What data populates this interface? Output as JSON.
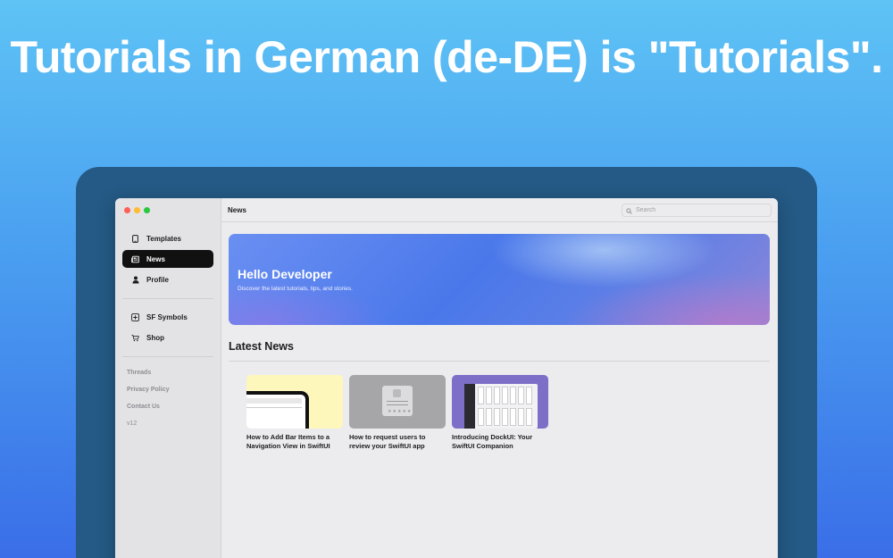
{
  "headline": "Tutorials in German (de-DE) is \"Tutorials\".",
  "colors": {
    "background_top": "#5ec3f5",
    "background_bottom": "#3a6ee8",
    "device": "#245a85",
    "sidebar_active": "#111111",
    "hero_start": "#6a8ff2",
    "hero_end": "#8c86d8"
  },
  "sidebar": {
    "items": [
      {
        "label": "Templates",
        "icon": "phone-icon",
        "active": false
      },
      {
        "label": "News",
        "icon": "newspaper-icon",
        "active": true
      },
      {
        "label": "Profile",
        "icon": "person-icon",
        "active": false
      },
      {
        "label": "SF Symbols",
        "icon": "symbols-grid-icon",
        "active": false
      },
      {
        "label": "Shop",
        "icon": "cart-icon",
        "active": false
      }
    ],
    "links": [
      "Threads",
      "Privacy Policy",
      "Contact Us"
    ],
    "version": "v12"
  },
  "topbar": {
    "title": "News",
    "search_placeholder": "Search"
  },
  "hero": {
    "title": "Hello Developer",
    "subtitle": "Discover the latest tutorials, tips, and stories."
  },
  "latest": {
    "title": "Latest News",
    "cards": [
      {
        "title": "How to Add Bar Items to a Navigation View in SwiftUI"
      },
      {
        "title": "How to request users to review your SwiftUI app"
      },
      {
        "title": "Introducing DockUI: Your SwiftUI Companion"
      }
    ]
  }
}
